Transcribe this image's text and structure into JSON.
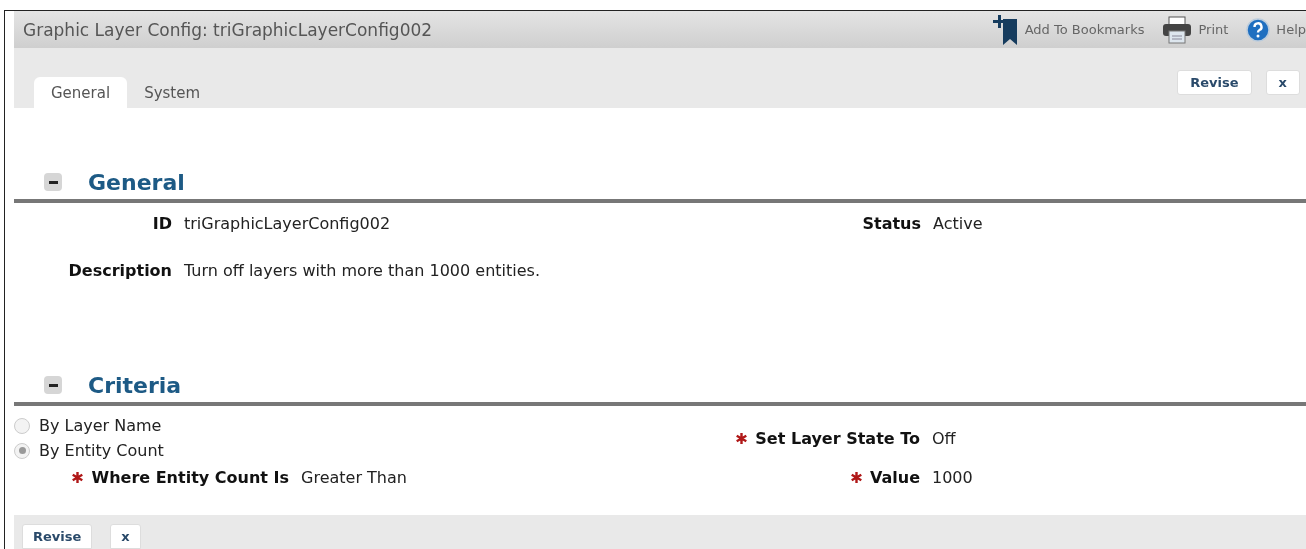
{
  "window": {
    "title": "Graphic Layer Config: triGraphicLayerConfig002"
  },
  "header_actions": [
    {
      "kind": "bookmark",
      "label": "Add To Bookmarks"
    },
    {
      "kind": "print",
      "label": "Print"
    },
    {
      "kind": "help",
      "label": "Help"
    }
  ],
  "tabs": [
    {
      "label": "General",
      "selected": true
    },
    {
      "label": "System",
      "selected": false
    }
  ],
  "top_buttons": [
    "Revise",
    "x"
  ],
  "sections": [
    {
      "title": "General",
      "expanded": true,
      "kind": "general",
      "fields": [
        {
          "label": "ID",
          "value": "triGraphicLayerConfig002",
          "required": false
        },
        {
          "label": "Status",
          "value": "Active",
          "required": false
        },
        {
          "label": "Description",
          "value": "Turn off layers with more than 1000 entities.",
          "required": false
        }
      ]
    },
    {
      "title": "Criteria",
      "expanded": true,
      "kind": "criteria",
      "radios": [
        {
          "label": "By Layer Name",
          "selected": false
        },
        {
          "label": "By Entity Count",
          "selected": true
        }
      ],
      "fields": [
        {
          "label": "Set Layer State To",
          "value": "Off",
          "required": true
        },
        {
          "label": "Where Entity Count Is",
          "value": "Greater Than",
          "required": true
        },
        {
          "label": "Value",
          "value": "1000",
          "required": true
        }
      ]
    }
  ],
  "bottom_buttons": [
    "Revise",
    "x"
  ]
}
